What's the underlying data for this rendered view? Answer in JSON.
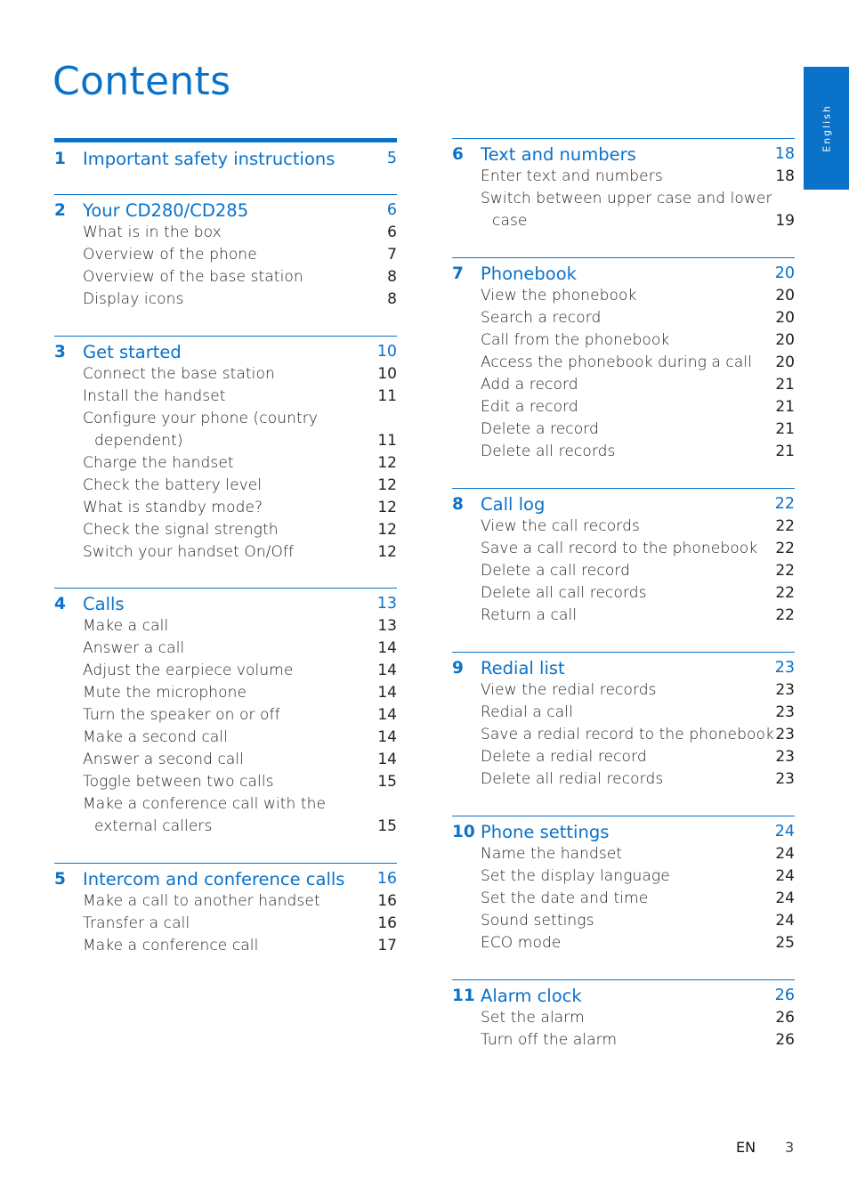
{
  "page": {
    "title": "Contents",
    "language_tab": "English",
    "footer": {
      "language": "EN",
      "page_number": "3"
    },
    "accent_color": "#0b72c9"
  },
  "sections": [
    {
      "number": "1",
      "title": "Important safety instructions",
      "page": "5",
      "items": []
    },
    {
      "number": "2",
      "title": "Your CD280/CD285",
      "page": "6",
      "items": [
        {
          "title": "What is in the box",
          "page": "6"
        },
        {
          "title": "Overview of the phone",
          "page": "7"
        },
        {
          "title": "Overview of the base station",
          "page": "8"
        },
        {
          "title": "Display icons",
          "page": "8"
        }
      ]
    },
    {
      "number": "3",
      "title": "Get started",
      "page": "10",
      "items": [
        {
          "title": "Connect the base station",
          "page": "10"
        },
        {
          "title": "Install the handset",
          "page": "11"
        },
        {
          "title": "Configure your phone (country",
          "continuation": "dependent)",
          "page": "11"
        },
        {
          "title": "Charge the handset",
          "page": "12"
        },
        {
          "title": "Check the battery level",
          "page": "12"
        },
        {
          "title": "What is standby mode?",
          "page": "12"
        },
        {
          "title": "Check the signal strength",
          "page": "12"
        },
        {
          "title": "Switch your handset On/Off",
          "page": "12"
        }
      ]
    },
    {
      "number": "4",
      "title": "Calls",
      "page": "13",
      "items": [
        {
          "title": "Make a call",
          "page": "13"
        },
        {
          "title": "Answer a call",
          "page": "14"
        },
        {
          "title": "Adjust the earpiece volume",
          "page": "14"
        },
        {
          "title": "Mute the microphone",
          "page": "14"
        },
        {
          "title": "Turn the speaker on or off",
          "page": "14"
        },
        {
          "title": "Make a second call",
          "page": "14"
        },
        {
          "title": "Answer a second call",
          "page": "14"
        },
        {
          "title": "Toggle between two calls",
          "page": "15"
        },
        {
          "title": "Make a conference call with the",
          "continuation": "external callers",
          "page": "15"
        }
      ]
    },
    {
      "number": "5",
      "title": "Intercom and conference calls",
      "page": "16",
      "items": [
        {
          "title": "Make a call to another handset",
          "page": "16"
        },
        {
          "title": "Transfer a call",
          "page": "16"
        },
        {
          "title": "Make a conference call",
          "page": "17"
        }
      ]
    },
    {
      "number": "6",
      "title": "Text and numbers",
      "page": "18",
      "items": [
        {
          "title": "Enter text and numbers",
          "page": "18"
        },
        {
          "title": "Switch between upper case and lower",
          "continuation": "case",
          "page": "19"
        }
      ]
    },
    {
      "number": "7",
      "title": "Phonebook",
      "page": "20",
      "items": [
        {
          "title": "View the phonebook",
          "page": "20"
        },
        {
          "title": "Search a record",
          "page": "20"
        },
        {
          "title": "Call from the phonebook",
          "page": "20"
        },
        {
          "title": "Access the phonebook during a call",
          "page": "20"
        },
        {
          "title": "Add a record",
          "page": "21"
        },
        {
          "title": "Edit a record",
          "page": "21"
        },
        {
          "title": "Delete a record",
          "page": "21"
        },
        {
          "title": "Delete all records",
          "page": "21"
        }
      ]
    },
    {
      "number": "8",
      "title": "Call log",
      "page": "22",
      "items": [
        {
          "title": "View the call records",
          "page": "22"
        },
        {
          "title": "Save a call record to the phonebook",
          "page": "22"
        },
        {
          "title": "Delete a call record",
          "page": "22"
        },
        {
          "title": "Delete all call records",
          "page": "22"
        },
        {
          "title": "Return a call",
          "page": "22"
        }
      ]
    },
    {
      "number": "9",
      "title": "Redial list",
      "page": "23",
      "items": [
        {
          "title": "View the redial records",
          "page": "23"
        },
        {
          "title": "Redial a call",
          "page": "23"
        },
        {
          "title": "Save a redial record to the phonebook",
          "page": "23"
        },
        {
          "title": "Delete a redial record",
          "page": "23"
        },
        {
          "title": "Delete all redial records",
          "page": "23"
        }
      ]
    },
    {
      "number": "10",
      "title": "Phone settings",
      "page": "24",
      "items": [
        {
          "title": "Name the handset",
          "page": "24"
        },
        {
          "title": "Set the display language",
          "page": "24"
        },
        {
          "title": "Set the date and time",
          "page": "24"
        },
        {
          "title": "Sound settings",
          "page": "24"
        },
        {
          "title": "ECO mode",
          "page": "25"
        }
      ]
    },
    {
      "number": "11",
      "title": "Alarm clock",
      "page": "26",
      "items": [
        {
          "title": "Set the alarm",
          "page": "26"
        },
        {
          "title": "Turn off the alarm",
          "page": "26"
        }
      ]
    }
  ]
}
